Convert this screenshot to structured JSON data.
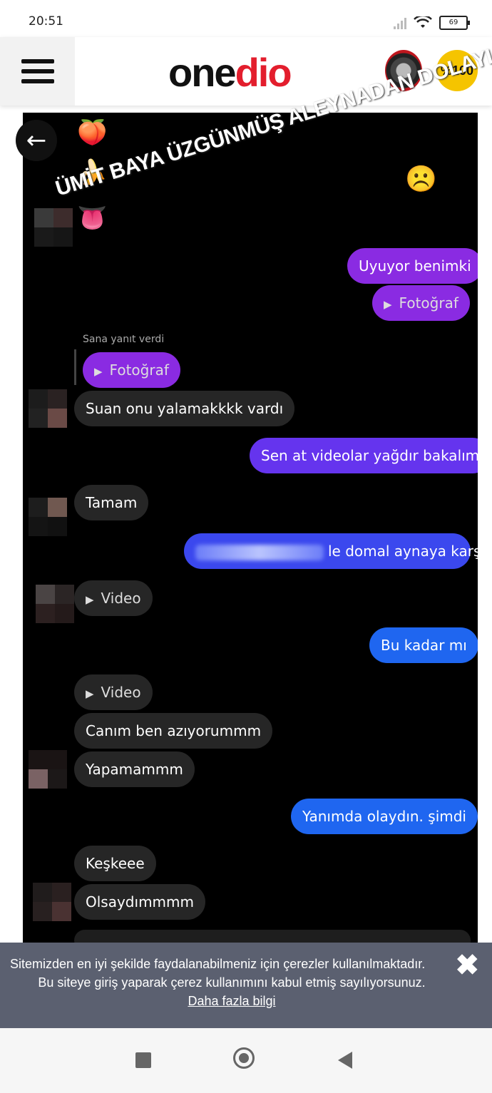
{
  "status_bar": {
    "time": "20:51",
    "battery": "69"
  },
  "header": {
    "logo_one": "one",
    "logo_dio": "dio",
    "badge_text": "%100"
  },
  "story": {
    "overlay_text": "ÜMİT BAYA ÜZGÜNMÜŞ ALEYNADAN DOLAYI",
    "reply_label": "Sana yanıt verdi"
  },
  "messages": [
    {
      "from": "me",
      "text": "Uyuyor benimki"
    },
    {
      "from": "me",
      "text": "Fotoğraf"
    },
    {
      "from": "them",
      "text": "Fotoğraf"
    },
    {
      "from": "them",
      "text": "Suan onu yalamakkkk vardı"
    },
    {
      "from": "me",
      "text": "Sen at videolar yağdır bakalım"
    },
    {
      "from": "them",
      "text": "Tamam"
    },
    {
      "from": "me",
      "text": "le domal aynaya karşı"
    },
    {
      "from": "them",
      "text": "Video"
    },
    {
      "from": "me",
      "text": "Bu kadar mı"
    },
    {
      "from": "them",
      "text": "Video"
    },
    {
      "from": "them",
      "text": "Canım ben azıyorummm"
    },
    {
      "from": "them",
      "text": "Yapamammm"
    },
    {
      "from": "me",
      "text": "Yanımda olaydın.  şimdi"
    },
    {
      "from": "them",
      "text": "Keşkeee"
    },
    {
      "from": "them",
      "text": "Olsaydımmmm"
    }
  ],
  "cookie_banner": {
    "line1": "Sitemizden en iyi şekilde faydalanabilmeniz için çerezler kullanılmaktadır.",
    "line2": "Bu siteye giriş yaparak çerez kullanımını kabul etmiş sayılıyorsunuz.",
    "more_link": "Daha fazla bilgi",
    "close": "✖"
  },
  "icons": {
    "back": "arrow-left-icon",
    "menu": "hamburger-icon",
    "play": "play-icon"
  },
  "colors": {
    "brand_red": "#e31e2d",
    "purple_bubble": "#8a2be2",
    "blue_bubble": "#1f66f0",
    "incoming_bubble": "#262626"
  }
}
